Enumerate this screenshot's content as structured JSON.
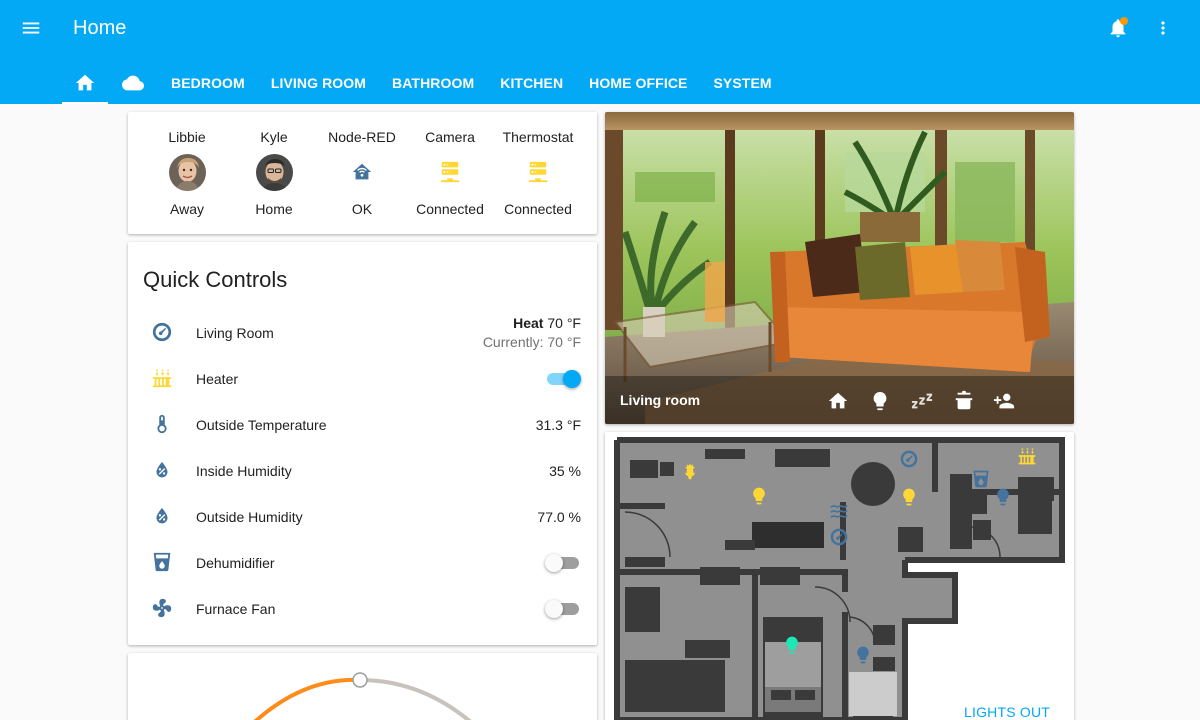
{
  "header": {
    "title": "Home",
    "tabs": [
      {
        "type": "icon",
        "icon": "home-icon"
      },
      {
        "type": "icon",
        "icon": "cloud-icon"
      },
      {
        "label": "BEDROOM"
      },
      {
        "label": "LIVING ROOM"
      },
      {
        "label": "BATHROOM"
      },
      {
        "label": "KITCHEN"
      },
      {
        "label": "HOME OFFICE"
      },
      {
        "label": "SYSTEM"
      }
    ],
    "has_notification": true
  },
  "badges": [
    {
      "name": "Libbie",
      "state": "Away",
      "kind": "person"
    },
    {
      "name": "Kyle",
      "state": "Home",
      "kind": "person"
    },
    {
      "name": "Node-RED",
      "state": "OK",
      "icon": "home-automation-icon"
    },
    {
      "name": "Camera",
      "state": "Connected",
      "icon": "server-icon"
    },
    {
      "name": "Thermostat",
      "state": "Connected",
      "icon": "server-icon"
    }
  ],
  "quick_controls": {
    "title": "Quick Controls",
    "rows": [
      {
        "label": "Living Room",
        "icon": "thermostat-icon",
        "mode": "Heat",
        "target": "70 °F",
        "current": "Currently: 70 °F"
      },
      {
        "label": "Heater",
        "icon": "radiator-icon",
        "toggle": true
      },
      {
        "label": "Outside Temperature",
        "icon": "thermometer-icon",
        "value": "31.3 °F"
      },
      {
        "label": "Inside Humidity",
        "icon": "water-percent-icon",
        "value": "35 %"
      },
      {
        "label": "Outside Humidity",
        "icon": "water-percent-icon",
        "value": "77.0 %"
      },
      {
        "label": "Dehumidifier",
        "icon": "cup-water-icon",
        "toggle": false
      },
      {
        "label": "Furnace Fan",
        "icon": "fan-icon",
        "toggle": false
      }
    ]
  },
  "camera": {
    "label": "Living room",
    "actions": [
      "home-icon",
      "lightbulb-icon",
      "sleep-icon",
      "pot-icon",
      "account-plus-icon"
    ]
  },
  "floorplan": {
    "action_label": "LIGHTS OUT"
  },
  "colors": {
    "primary": "#03a9f4",
    "accent": "#ff9800",
    "state_icon": "#44739e",
    "active_icon": "#fdd835",
    "teal_light": "#1de9b6"
  }
}
